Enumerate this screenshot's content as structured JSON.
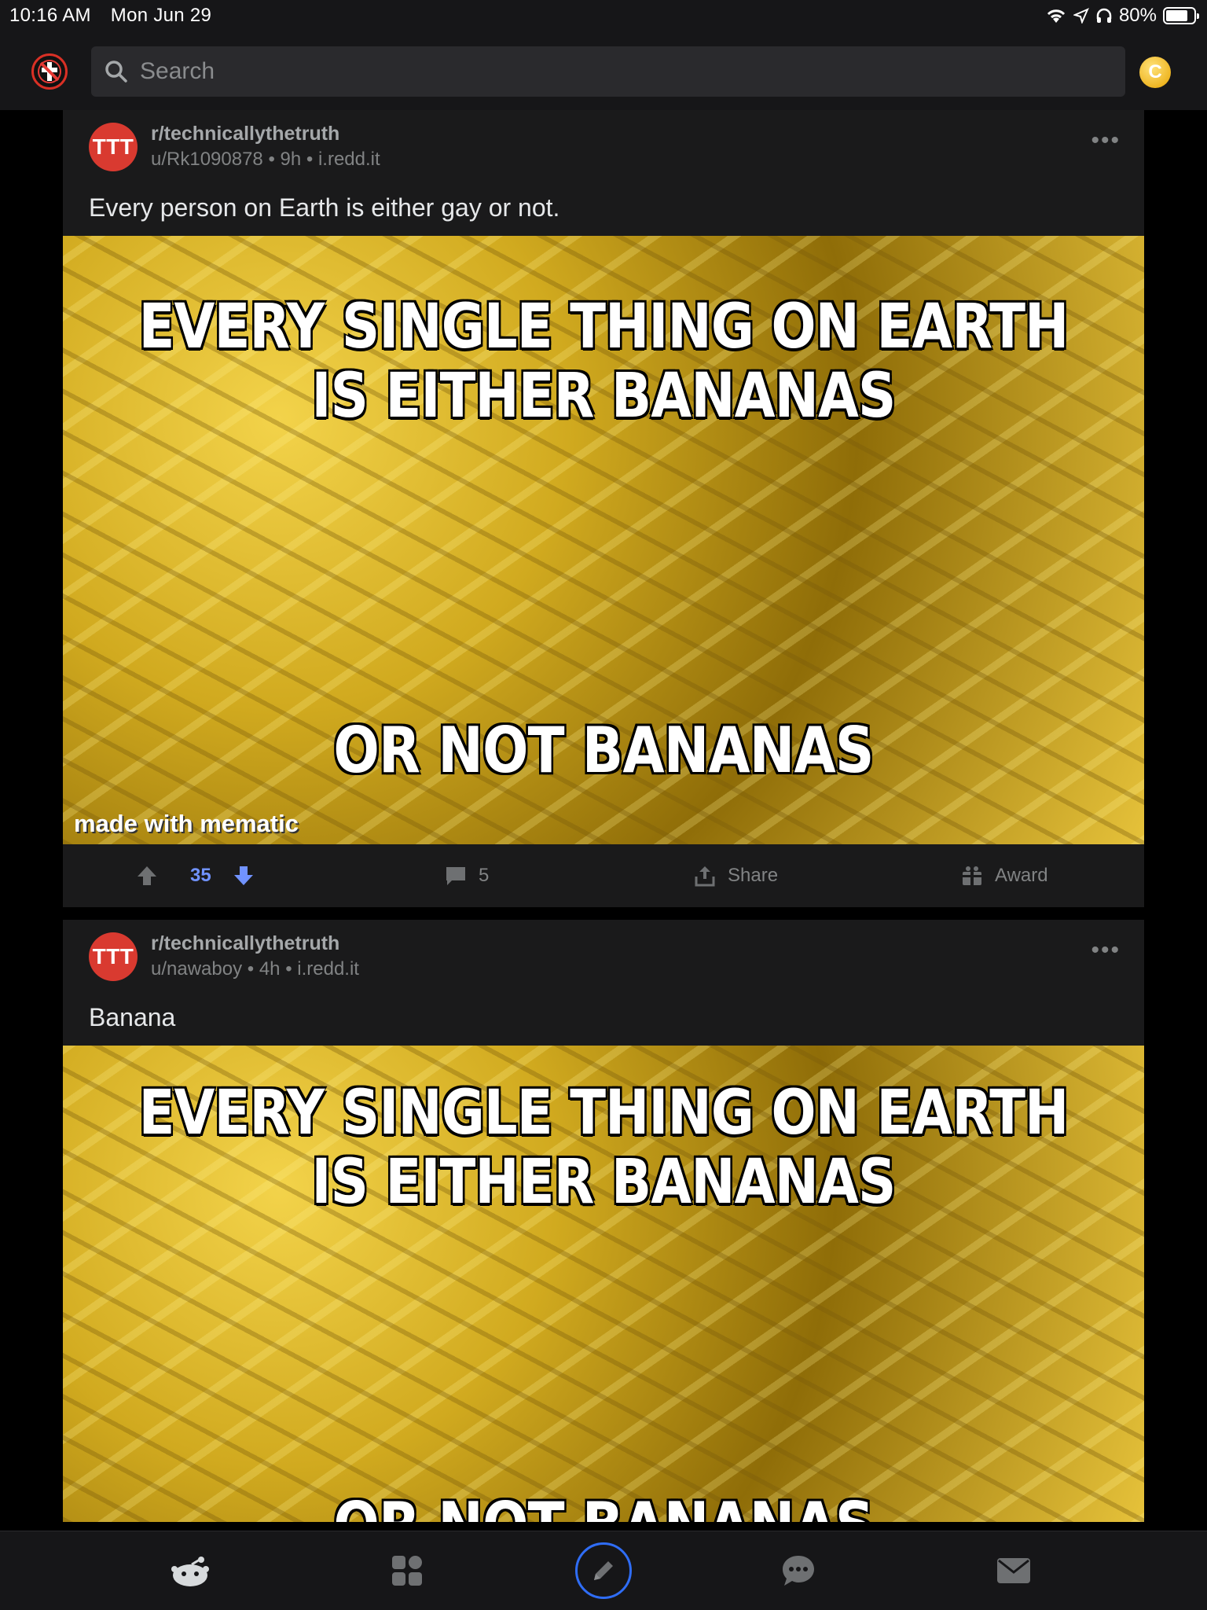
{
  "status_bar": {
    "time": "10:16 AM",
    "date": "Mon Jun 29",
    "battery": "80%",
    "battery_level": 0.8
  },
  "header": {
    "search_placeholder": "Search"
  },
  "posts": [
    {
      "avatar_text": "TTT",
      "subreddit": "r/technicallythetruth",
      "meta": "u/Rk1090878 • 9h • i.redd.it",
      "title": "Every person on Earth is either gay or not.",
      "meme_top": "EVERY SINGLE THING ON EARTH IS EITHER BANANAS",
      "meme_bottom": "OR NOT BANANAS",
      "watermark": "made with mematic",
      "votes": "35",
      "comments": "5",
      "share_label": "Share",
      "award_label": "Award"
    },
    {
      "avatar_text": "TTT",
      "subreddit": "r/technicallythetruth",
      "meta": "u/nawaboy • 4h • i.redd.it",
      "title": "Banana",
      "meme_top": "EVERY SINGLE THING ON EARTH IS EITHER BANANAS",
      "meme_bottom": "OR NOT BANANAS"
    }
  ],
  "colors": {
    "upvote_accent": "#7193ff",
    "avatar": "#d93a30",
    "post_tab_ring": "#2f6df6"
  },
  "icons": [
    "snoo-home-icon",
    "grid-icon",
    "pencil-icon",
    "chat-icon",
    "mail-icon",
    "search-icon",
    "coin-icon",
    "upvote-icon",
    "downvote-icon",
    "comment-icon",
    "share-icon",
    "gift-icon",
    "more-icon"
  ]
}
